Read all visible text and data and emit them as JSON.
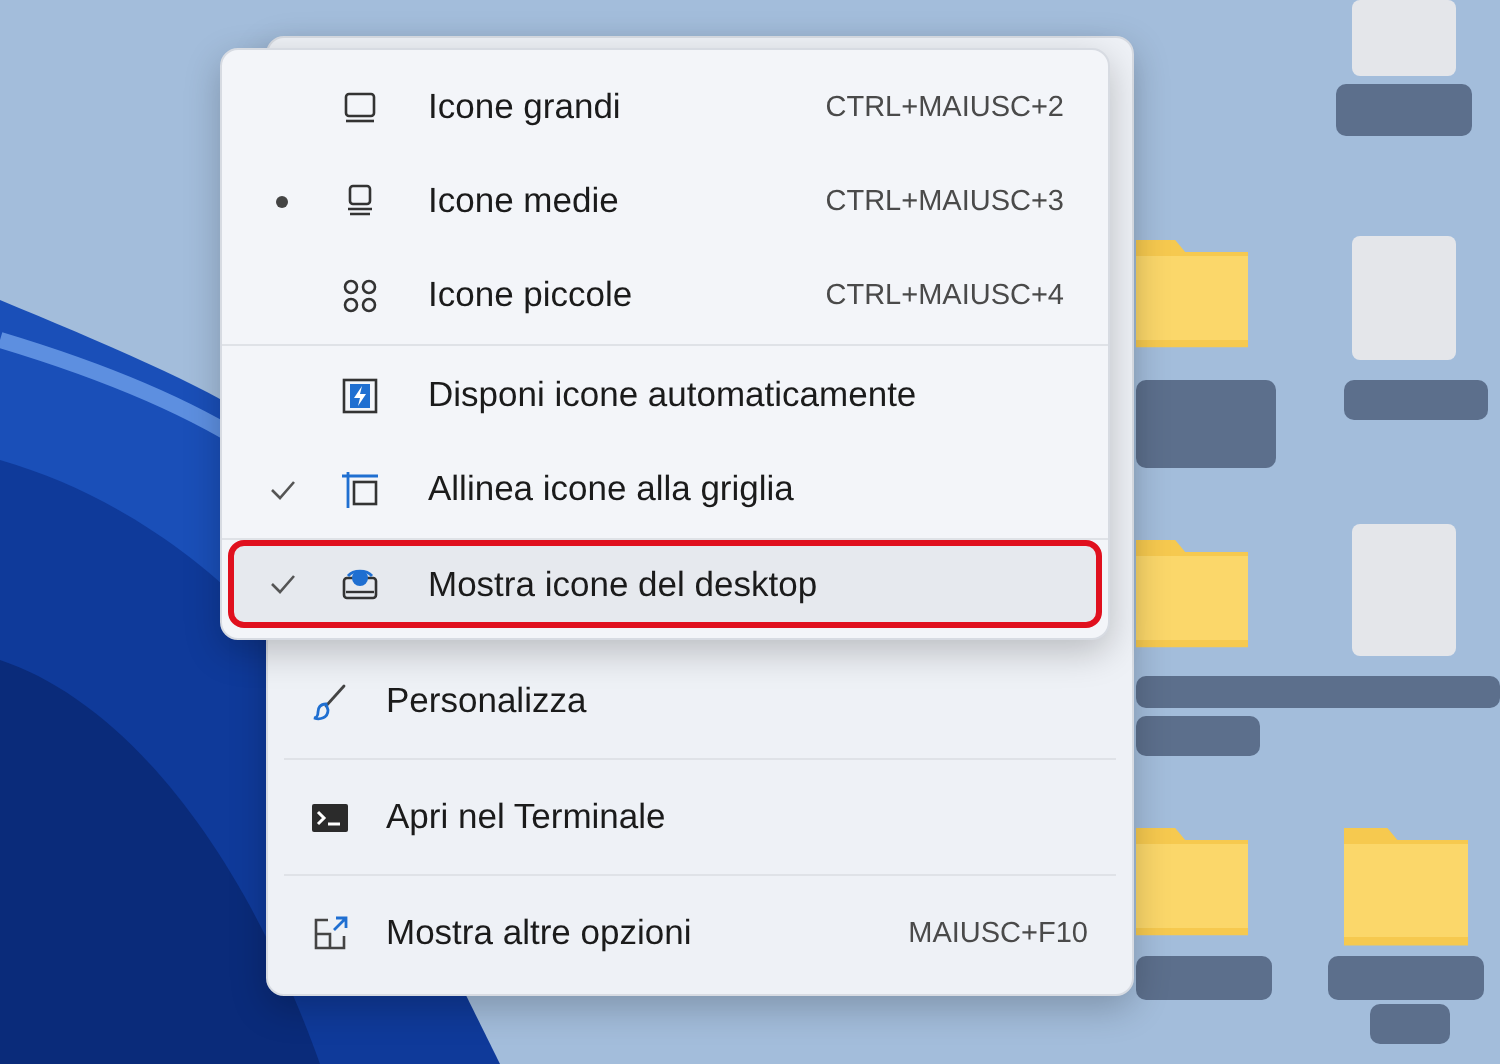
{
  "submenu": {
    "groups": [
      [
        {
          "kind": "radio",
          "label": "Icone grandi",
          "shortcut": "CTRL+MAIUSC+2",
          "selected": false,
          "hovered": false,
          "outlined": false
        },
        {
          "kind": "radio",
          "label": "Icone medie",
          "shortcut": "CTRL+MAIUSC+3",
          "selected": true,
          "hovered": false,
          "outlined": false
        },
        {
          "kind": "radio",
          "label": "Icone piccole",
          "shortcut": "CTRL+MAIUSC+4",
          "selected": false,
          "hovered": false,
          "outlined": false
        }
      ],
      [
        {
          "kind": "check",
          "label": "Disponi icone automaticamente",
          "checked": false,
          "hovered": false,
          "outlined": false
        },
        {
          "kind": "check",
          "label": "Allinea icone alla griglia",
          "checked": true,
          "hovered": false,
          "outlined": false
        }
      ],
      [
        {
          "kind": "check",
          "label": "Mostra icone del desktop",
          "checked": true,
          "hovered": true,
          "outlined": true
        }
      ]
    ]
  },
  "context_menu": {
    "items": [
      {
        "label": "Personalizza"
      },
      {
        "label": "Apri nel Terminale"
      },
      {
        "label": "Mostra altre opzioni",
        "shortcut": "MAIUSC+F10"
      }
    ]
  }
}
